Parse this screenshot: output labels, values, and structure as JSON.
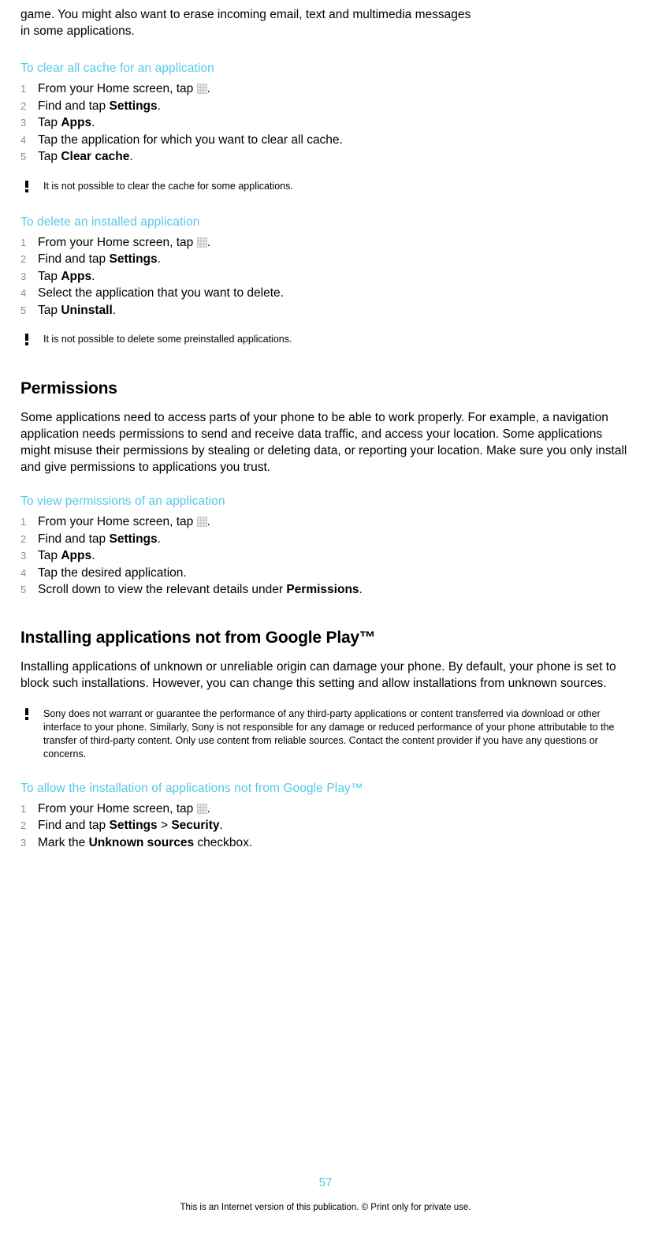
{
  "intro": {
    "line1": "game. You might also want to erase incoming email, text and multimedia messages",
    "line2": "in some applications."
  },
  "sections": [
    {
      "heading": "To clear all cache for an application",
      "steps": [
        "From your Home screen, tap APPS_ICON.",
        "Find and tap Settings.",
        "Tap Apps.",
        "Tap the application for which you want to clear all cache.",
        "Tap Clear cache."
      ],
      "note": "It is not possible to clear the cache for some applications."
    },
    {
      "heading": "To delete an installed application",
      "steps": [
        "From your Home screen, tap APPS_ICON.",
        "Find and tap Settings.",
        "Tap Apps.",
        "Select the application that you want to delete.",
        "Tap Uninstall."
      ],
      "note": "It is not possible to delete some preinstalled applications."
    }
  ],
  "permissions": {
    "heading": "Permissions",
    "body": "Some applications need to access parts of your phone to be able to work properly. For example, a navigation application needs permissions to send and receive data traffic, and access your location. Some applications might misuse their permissions by stealing or deleting data, or reporting your location. Make sure you only install and give permissions to applications you trust.",
    "task_heading": "To view permissions of an application",
    "steps": [
      "From your Home screen, tap APPS_ICON.",
      "Find and tap Settings.",
      "Tap Apps.",
      "Tap the desired application.",
      "Scroll down to view the relevant details under Permissions."
    ]
  },
  "installing": {
    "heading": "Installing applications not from Google Play™",
    "body": "Installing applications of unknown or unreliable origin can damage your phone. By default, your phone is set to block such installations. However, you can change this setting and allow installations from unknown sources.",
    "note": "Sony does not warrant or guarantee the performance of any third-party applications or content transferred via download or other interface to your phone. Similarly, Sony is not responsible for any damage or reduced performance of your phone attributable to the transfer of third-party content. Only use content from reliable sources. Contact the content provider if you have any questions or concerns.",
    "task_heading": "To allow the installation of applications not from Google Play™",
    "steps": [
      "From your Home screen, tap APPS_ICON.",
      "Find and tap Settings > Security.",
      "Mark the Unknown sources checkbox."
    ]
  },
  "footer": {
    "page_number": "57",
    "disclaimer": "This is an Internet version of this publication. © Print only for private use."
  },
  "colors": {
    "heading_accent": "#55c7e8",
    "step_number": "#8c8c8c",
    "text": "#000000"
  }
}
